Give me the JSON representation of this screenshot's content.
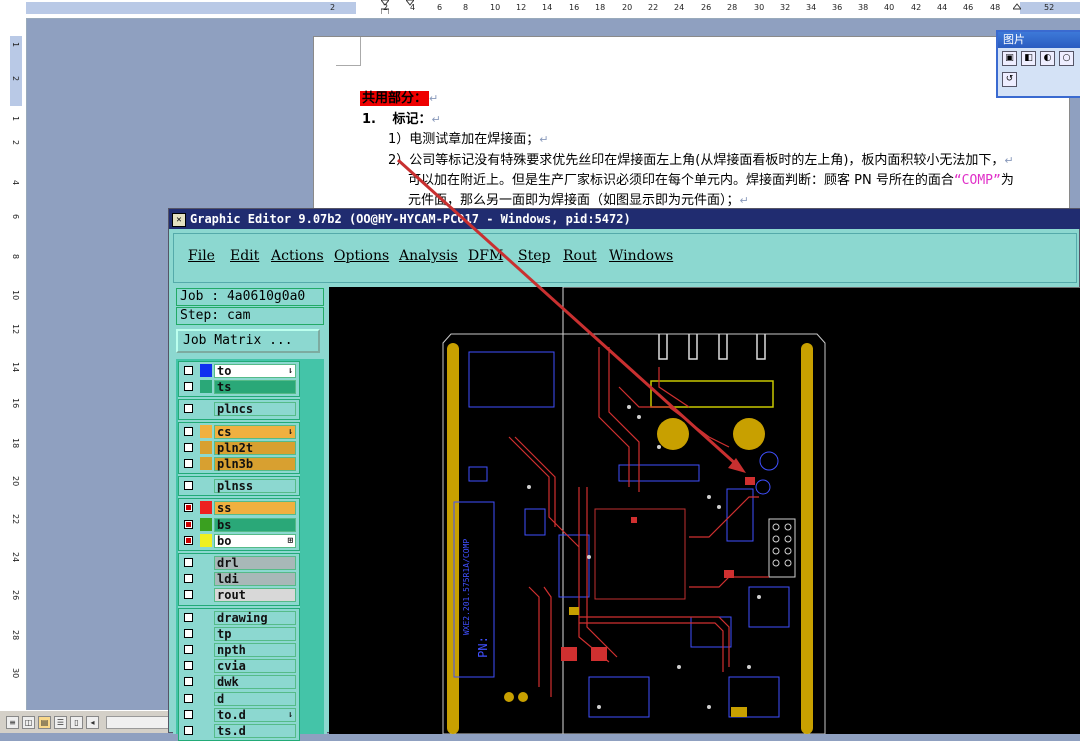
{
  "word": {
    "ruler_ticks": [
      "2",
      "2",
      "4",
      "6",
      "8",
      "10",
      "12",
      "14",
      "16",
      "18",
      "20",
      "22",
      "24",
      "26",
      "28",
      "30",
      "32",
      "34",
      "36",
      "38",
      "40",
      "42",
      "44",
      "46",
      "48",
      "52"
    ],
    "vruler_ticks": [
      "1",
      "2",
      "1",
      "2",
      "4",
      "6",
      "8",
      "10",
      "12",
      "14",
      "16",
      "18",
      "20",
      "22",
      "24",
      "26",
      "28",
      "30"
    ],
    "doc_lines": {
      "heading": "共用部分：",
      "item1_num": "1.",
      "item1_label": "标记：",
      "sub1": "1）电测试章加在焊接面；",
      "sub2a": "2）公司等标记没有特殊要求优先丝印在焊接面左上角(从焊接面看板时的左上角)，板内面积较小无法加下，",
      "sub2b_pre": "可以加在附近上。但是生产厂家标识必须印在每个单元内。焊接面判断：顾客 PN 号所在的面合",
      "sub2b_comp": "“COMP”",
      "sub2b_post": "为",
      "sub2c": "元件面，那么另一面即为焊接面（如图显示即为元件面）；",
      "para_mark": "↵"
    },
    "picture_toolbar_title": "图片"
  },
  "editor": {
    "title": "Graphic Editor 9.07b2 (OO@HY-HYCAM-PC017 - Windows, pid:5472)",
    "menu": [
      "File",
      "Edit",
      "Actions",
      "Options",
      "Analysis",
      "DFM",
      "Step",
      "Rout",
      "Windows"
    ],
    "job_label": "Job : 4a0610g0a0",
    "step_label": "Step: cam",
    "job_matrix_label": "Job Matrix ...",
    "layers": [
      {
        "name": "to",
        "color": "#1030f0",
        "bg": "#ffffff",
        "marker": "⇂",
        "checked": false
      },
      {
        "name": "ts",
        "color": "#2aa878",
        "bg": "#2aa878",
        "marker": "",
        "checked": false
      },
      {
        "name": "plncs",
        "color": "#8cd8d0",
        "bg": "#8cd8d0",
        "marker": "",
        "checked": false
      },
      {
        "name": "cs",
        "color": "#f0b040",
        "bg": "#f0b040",
        "marker": "⇂",
        "checked": false
      },
      {
        "name": "pln2t",
        "color": "#d8a030",
        "bg": "#d8a030",
        "marker": "",
        "checked": false
      },
      {
        "name": "pln3b",
        "color": "#d8a030",
        "bg": "#d8a030",
        "marker": "",
        "checked": false
      },
      {
        "name": "plnss",
        "color": "#8cd8d0",
        "bg": "#8cd8d0",
        "marker": "",
        "checked": false
      },
      {
        "name": "ss",
        "color": "#ee2020",
        "bg": "#f0b040",
        "marker": "",
        "checked": true
      },
      {
        "name": "bs",
        "color": "#3aa020",
        "bg": "#2aa878",
        "marker": "",
        "checked": true
      },
      {
        "name": "bo",
        "color": "#f0f020",
        "bg": "#ffffff",
        "marker": "⊞",
        "checked": true
      },
      {
        "name": "drl",
        "color": "#8cd8d0",
        "bg": "#a8b8b8",
        "marker": "",
        "checked": false
      },
      {
        "name": "ldi",
        "color": "#8cd8d0",
        "bg": "#a8b8b8",
        "marker": "",
        "checked": false
      },
      {
        "name": "rout",
        "color": "#8cd8d0",
        "bg": "#d8d8d8",
        "marker": "",
        "checked": false
      },
      {
        "name": "drawing",
        "color": "#8cd8d0",
        "bg": "#8cd8d0",
        "marker": "",
        "checked": false
      },
      {
        "name": "tp",
        "color": "#8cd8d0",
        "bg": "#8cd8d0",
        "marker": "",
        "checked": false
      },
      {
        "name": "npth",
        "color": "#8cd8d0",
        "bg": "#8cd8d0",
        "marker": "",
        "checked": false
      },
      {
        "name": "cvia",
        "color": "#8cd8d0",
        "bg": "#8cd8d0",
        "marker": "",
        "checked": false
      },
      {
        "name": "dwk",
        "color": "#8cd8d0",
        "bg": "#8cd8d0",
        "marker": "",
        "checked": false
      },
      {
        "name": "d",
        "color": "#8cd8d0",
        "bg": "#8cd8d0",
        "marker": "",
        "checked": false
      },
      {
        "name": "to.d",
        "color": "#8cd8d0",
        "bg": "#8cd8d0",
        "marker": "⇂",
        "checked": false
      },
      {
        "name": "ts.d",
        "color": "#8cd8d0",
        "bg": "#8cd8d0",
        "marker": "",
        "checked": false
      }
    ],
    "board_text": {
      "vertical_label": "WXE2.201.575R1A/COMP",
      "pn_label": "PN:"
    }
  }
}
